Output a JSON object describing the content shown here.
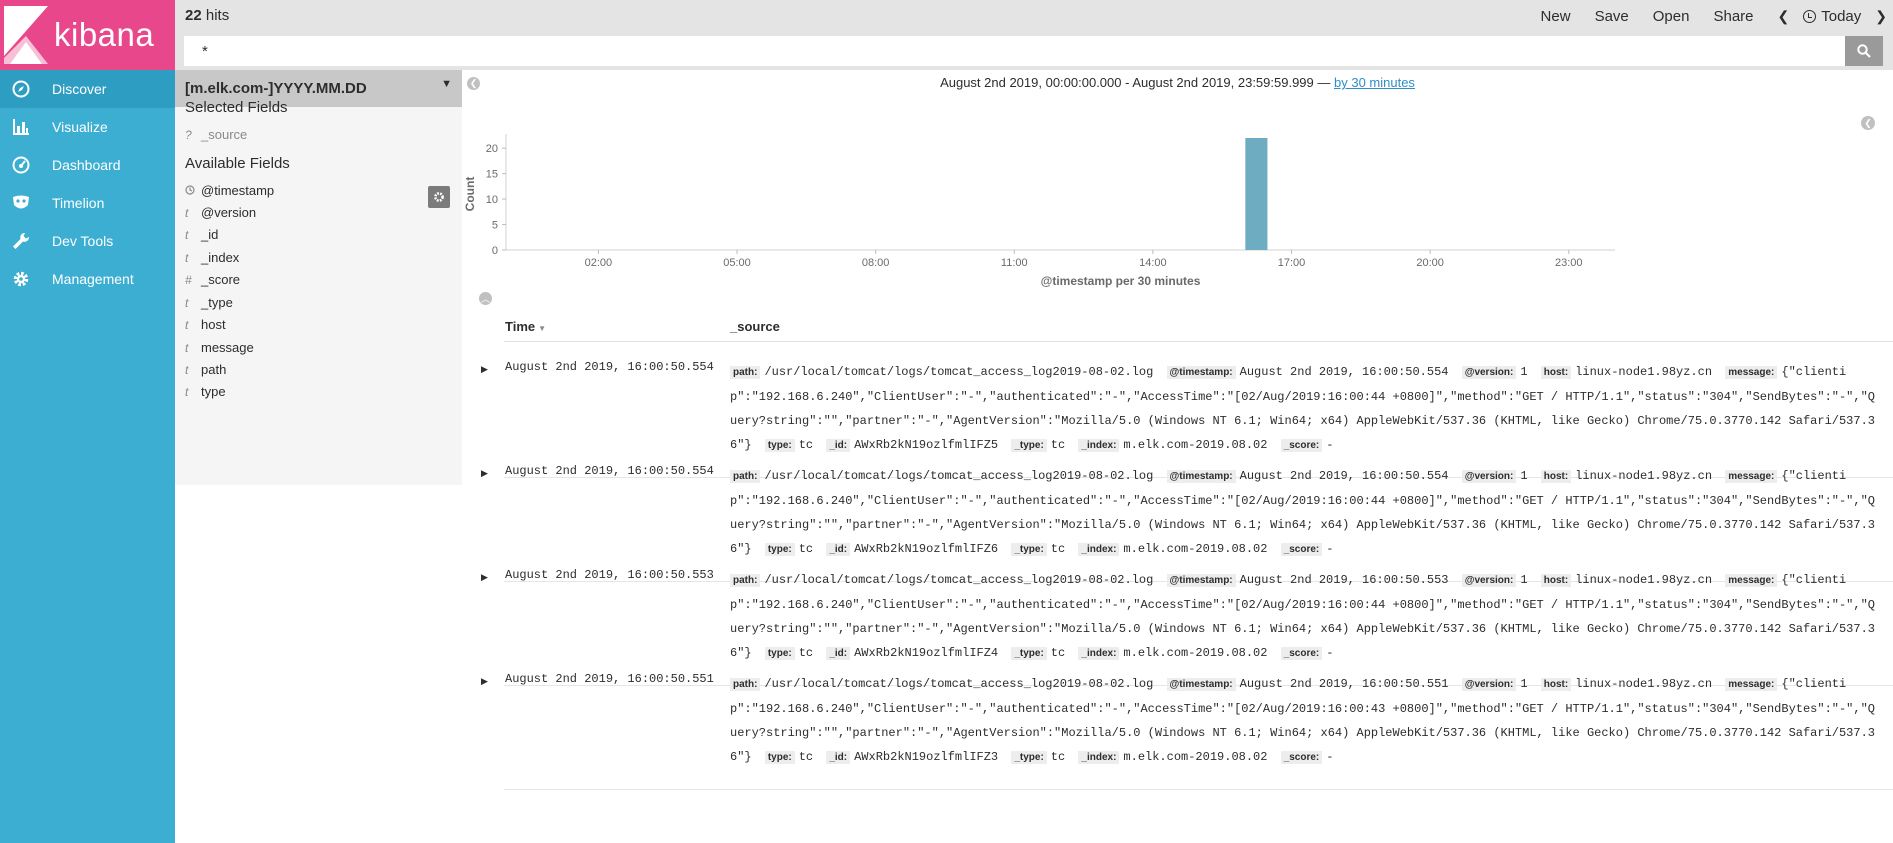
{
  "nav": {
    "brand": "kibana",
    "items": [
      {
        "label": "Discover",
        "icon": "compass-icon",
        "active": true
      },
      {
        "label": "Visualize",
        "icon": "bar-chart-icon",
        "active": false
      },
      {
        "label": "Dashboard",
        "icon": "dashboard-gauge-icon",
        "active": false
      },
      {
        "label": "Timelion",
        "icon": "timelion-mask-icon",
        "active": false
      },
      {
        "label": "Dev Tools",
        "icon": "wrench-icon",
        "active": false
      },
      {
        "label": "Management",
        "icon": "gear-icon",
        "active": false
      }
    ]
  },
  "topbar": {
    "hits_count": "22",
    "hits_label": " hits",
    "new_label": "New",
    "save_label": "Save",
    "open_label": "Open",
    "share_label": "Share",
    "prev_label": "❮",
    "next_label": "❯",
    "today_label": "Today"
  },
  "query": {
    "value": "*"
  },
  "sidebar": {
    "index_pattern": "[m.elk.com-]YYYY.MM.DD",
    "selected_title": "Selected Fields",
    "selected_fields": [
      {
        "type": "?",
        "name": "_source"
      }
    ],
    "available_title": "Available Fields",
    "available_fields": [
      {
        "type": "clock",
        "name": "@timestamp"
      },
      {
        "type": "t",
        "name": "@version"
      },
      {
        "type": "t",
        "name": "_id"
      },
      {
        "type": "t",
        "name": "_index"
      },
      {
        "type": "#",
        "name": "_score"
      },
      {
        "type": "t",
        "name": "_type"
      },
      {
        "type": "t",
        "name": "host"
      },
      {
        "type": "t",
        "name": "message"
      },
      {
        "type": "t",
        "name": "path"
      },
      {
        "type": "t",
        "name": "type"
      }
    ]
  },
  "histogram": {
    "range_text": "August 2nd 2019, 00:00:00.000 - August 2nd 2019, 23:59:59.999 — ",
    "interval_link": "by 30 minutes"
  },
  "chart_data": {
    "type": "bar",
    "xlabel": "@timestamp per 30 minutes",
    "ylabel": "Count",
    "ylim": [
      0,
      22
    ],
    "yticks": [
      0,
      5,
      10,
      15,
      20
    ],
    "x_ticks": [
      "02:00",
      "05:00",
      "08:00",
      "11:00",
      "14:00",
      "17:00",
      "20:00",
      "23:00"
    ],
    "x_range_hours": [
      0,
      24
    ],
    "bars": [
      {
        "start": "16:00",
        "end": "16:30",
        "value": 22
      }
    ],
    "color": "#6eadc1"
  },
  "table": {
    "time_header": "Time",
    "source_header": "_source",
    "rows": [
      {
        "time": "August 2nd 2019, 16:00:50.554",
        "fields": [
          {
            "k": "path:",
            "v": "/usr/local/tomcat/logs/tomcat_access_log2019-08-02.log"
          },
          {
            "k": "@timestamp:",
            "v": "August 2nd 2019, 16:00:50.554"
          },
          {
            "k": "@version:",
            "v": "1"
          },
          {
            "k": "host:",
            "v": "linux-node1.98yz.cn"
          },
          {
            "k": "message:",
            "v": "{\"clientip\":\"192.168.6.240\",\"ClientUser\":\"-\",\"authenticated\":\"-\",\"AccessTime\":\"[02/Aug/2019:16:00:44 +0800]\",\"method\":\"GET / HTTP/1.1\",\"status\":\"304\",\"SendBytes\":\"-\",\"Query?string\":\"\",\"partner\":\"-\",\"AgentVersion\":\"Mozilla/5.0 (Windows NT 6.1; Win64; x64) AppleWebKit/537.36 (KHTML, like Gecko) Chrome/75.0.3770.142 Safari/537.36\"}"
          },
          {
            "k": "type:",
            "v": "tc"
          },
          {
            "k": "_id:",
            "v": "AWxRb2kN19ozlfmlIFZ5"
          },
          {
            "k": "_type:",
            "v": "tc"
          },
          {
            "k": "_index:",
            "v": "m.elk.com-2019.08.02"
          },
          {
            "k": "_score:",
            "v": "-"
          }
        ]
      },
      {
        "time": "August 2nd 2019, 16:00:50.554",
        "fields": [
          {
            "k": "path:",
            "v": "/usr/local/tomcat/logs/tomcat_access_log2019-08-02.log"
          },
          {
            "k": "@timestamp:",
            "v": "August 2nd 2019, 16:00:50.554"
          },
          {
            "k": "@version:",
            "v": "1"
          },
          {
            "k": "host:",
            "v": "linux-node1.98yz.cn"
          },
          {
            "k": "message:",
            "v": "{\"clientip\":\"192.168.6.240\",\"ClientUser\":\"-\",\"authenticated\":\"-\",\"AccessTime\":\"[02/Aug/2019:16:00:44 +0800]\",\"method\":\"GET / HTTP/1.1\",\"status\":\"304\",\"SendBytes\":\"-\",\"Query?string\":\"\",\"partner\":\"-\",\"AgentVersion\":\"Mozilla/5.0 (Windows NT 6.1; Win64; x64) AppleWebKit/537.36 (KHTML, like Gecko) Chrome/75.0.3770.142 Safari/537.36\"}"
          },
          {
            "k": "type:",
            "v": "tc"
          },
          {
            "k": "_id:",
            "v": "AWxRb2kN19ozlfmlIFZ6"
          },
          {
            "k": "_type:",
            "v": "tc"
          },
          {
            "k": "_index:",
            "v": "m.elk.com-2019.08.02"
          },
          {
            "k": "_score:",
            "v": "-"
          }
        ]
      },
      {
        "time": "August 2nd 2019, 16:00:50.553",
        "fields": [
          {
            "k": "path:",
            "v": "/usr/local/tomcat/logs/tomcat_access_log2019-08-02.log"
          },
          {
            "k": "@timestamp:",
            "v": "August 2nd 2019, 16:00:50.553"
          },
          {
            "k": "@version:",
            "v": "1"
          },
          {
            "k": "host:",
            "v": "linux-node1.98yz.cn"
          },
          {
            "k": "message:",
            "v": "{\"clientip\":\"192.168.6.240\",\"ClientUser\":\"-\",\"authenticated\":\"-\",\"AccessTime\":\"[02/Aug/2019:16:00:44 +0800]\",\"method\":\"GET / HTTP/1.1\",\"status\":\"304\",\"SendBytes\":\"-\",\"Query?string\":\"\",\"partner\":\"-\",\"AgentVersion\":\"Mozilla/5.0 (Windows NT 6.1; Win64; x64) AppleWebKit/537.36 (KHTML, like Gecko) Chrome/75.0.3770.142 Safari/537.36\"}"
          },
          {
            "k": "type:",
            "v": "tc"
          },
          {
            "k": "_id:",
            "v": "AWxRb2kN19ozlfmlIFZ4"
          },
          {
            "k": "_type:",
            "v": "tc"
          },
          {
            "k": "_index:",
            "v": "m.elk.com-2019.08.02"
          },
          {
            "k": "_score:",
            "v": "-"
          }
        ]
      },
      {
        "time": "August 2nd 2019, 16:00:50.551",
        "fields": [
          {
            "k": "path:",
            "v": "/usr/local/tomcat/logs/tomcat_access_log2019-08-02.log"
          },
          {
            "k": "@timestamp:",
            "v": "August 2nd 2019, 16:00:50.551"
          },
          {
            "k": "@version:",
            "v": "1"
          },
          {
            "k": "host:",
            "v": "linux-node1.98yz.cn"
          },
          {
            "k": "message:",
            "v": "{\"clientip\":\"192.168.6.240\",\"ClientUser\":\"-\",\"authenticated\":\"-\",\"AccessTime\":\"[02/Aug/2019:16:00:43 +0800]\",\"method\":\"GET / HTTP/1.1\",\"status\":\"304\",\"SendBytes\":\"-\",\"Query?string\":\"\",\"partner\":\"-\",\"AgentVersion\":\"Mozilla/5.0 (Windows NT 6.1; Win64; x64) AppleWebKit/537.36 (KHTML, like Gecko) Chrome/75.0.3770.142 Safari/537.36\"}"
          },
          {
            "k": "type:",
            "v": "tc"
          },
          {
            "k": "_id:",
            "v": "AWxRb2kN19ozlfmlIFZ3"
          },
          {
            "k": "_type:",
            "v": "tc"
          },
          {
            "k": "_index:",
            "v": "m.elk.com-2019.08.02"
          },
          {
            "k": "_score:",
            "v": "-"
          }
        ]
      }
    ]
  }
}
